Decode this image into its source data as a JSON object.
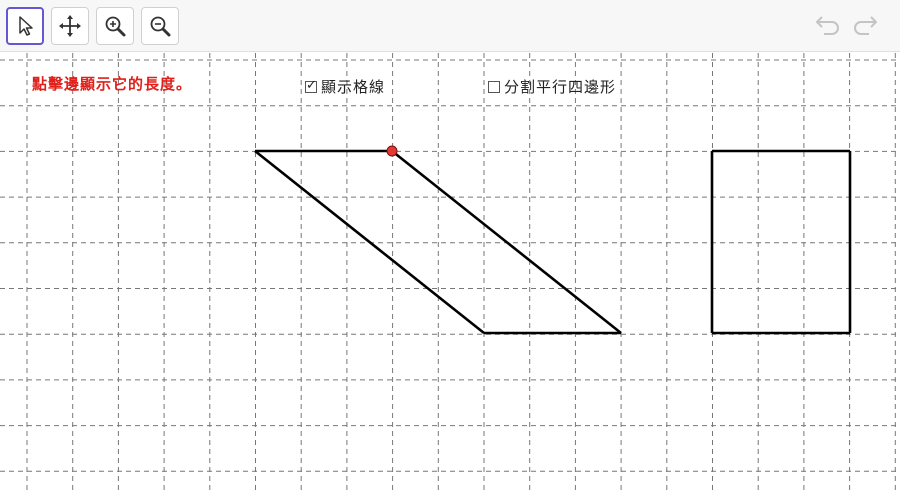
{
  "toolbar": {
    "tools": [
      {
        "id": "select",
        "icon": "cursor-arrow-icon"
      },
      {
        "id": "move",
        "icon": "move-arrows-icon"
      },
      {
        "id": "zoom-in",
        "icon": "zoom-in-icon"
      },
      {
        "id": "zoom-out",
        "icon": "zoom-out-icon"
      }
    ],
    "undo_icon": "undo-icon",
    "redo_icon": "redo-icon"
  },
  "hint_text": "點擊邊顯示它的長度。",
  "checkboxes": {
    "show_grid": {
      "label": "顯示格線",
      "checked": true
    },
    "split_parallelogram": {
      "label": "分割平行四邊形",
      "checked": false
    }
  },
  "colors": {
    "accent": "#6557d2",
    "hint": "#e0201b",
    "point": "#e53935",
    "shape_stroke": "#000000",
    "grid": "#777777"
  }
}
